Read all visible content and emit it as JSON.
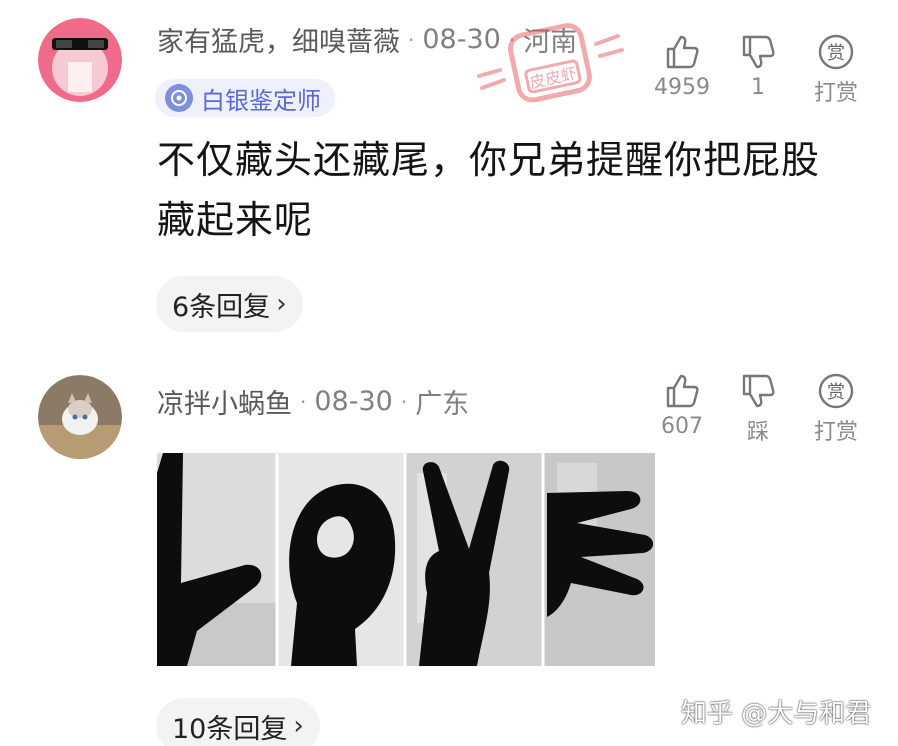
{
  "comments": [
    {
      "username": "家有猛虎，细嗅蔷薇",
      "time": "08-30",
      "location": "河南",
      "badge": "白银鉴定师",
      "text": "不仅藏头还藏尾，你兄弟提醒你把屁股藏起来呢",
      "likes": "4959",
      "dislikes": "1",
      "reward": "打赏",
      "replies": "6条回复"
    },
    {
      "username": "凉拌小蜗鱼",
      "time": "08-30",
      "location": "广东",
      "likes": "607",
      "dislikes": "踩",
      "reward": "打赏",
      "replies": "10条回复"
    }
  ],
  "stamp_text": "皮皮虾",
  "watermark": "知乎 @大与和君",
  "icons": {
    "like": "thumbs-up-icon",
    "dislike": "thumbs-down-icon",
    "reward": "reward-coin-icon",
    "reward_glyph": "赏"
  },
  "colors": {
    "badge_bg": "#eef0fb",
    "badge_text": "#5a6ad1",
    "stamp": "#e3464c"
  }
}
